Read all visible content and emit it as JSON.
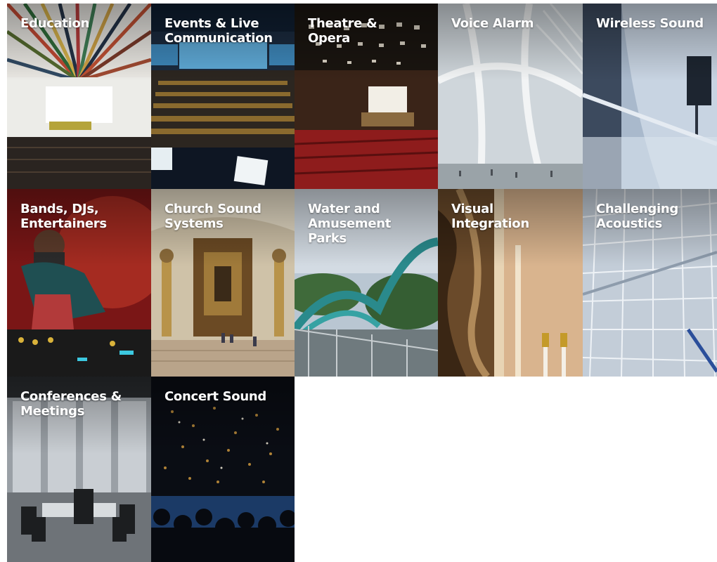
{
  "tiles": [
    {
      "label": "Education"
    },
    {
      "label": "Events & Live\nCommunication"
    },
    {
      "label": "Theatre &\nOpera"
    },
    {
      "label": "Voice Alarm"
    },
    {
      "label": "Wireless Sound"
    },
    {
      "label": "Bands, DJs,\nEntertainers"
    },
    {
      "label": "Church Sound\nSystems"
    },
    {
      "label": "Water and\nAmusement\nParks"
    },
    {
      "label": "Visual\nIntegration"
    },
    {
      "label": "Challenging\nAcoustics"
    },
    {
      "label": "Conferences &\nMeetings"
    },
    {
      "label": "Concert Sound"
    }
  ]
}
